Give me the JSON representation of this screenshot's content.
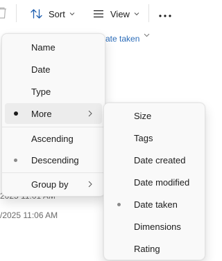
{
  "toolbar": {
    "sort_label": "Sort",
    "view_label": "View"
  },
  "background": {
    "column_header_fragment": "ate taken",
    "rows": [
      "2025 11:01 AM",
      "/2025 11:06 AM"
    ]
  },
  "sort_menu": {
    "items": [
      {
        "label": "Name"
      },
      {
        "label": "Date"
      },
      {
        "label": "Type"
      },
      {
        "label": "More",
        "checked": true,
        "submenu": true
      },
      {
        "label": "Ascending"
      },
      {
        "label": "Descending",
        "checked": true
      },
      {
        "label": "Group by",
        "submenu": true
      }
    ]
  },
  "more_submenu": {
    "items": [
      {
        "label": "Size"
      },
      {
        "label": "Tags"
      },
      {
        "label": "Date created"
      },
      {
        "label": "Date modified"
      },
      {
        "label": "Date taken",
        "checked": true
      },
      {
        "label": "Dimensions"
      },
      {
        "label": "Rating"
      }
    ]
  },
  "icons": {
    "trash": "trash-icon",
    "sort": "sort-arrows-icon",
    "view": "view-lines-icon",
    "more": "more-ellipsis-icon",
    "chevron": "chevron-down-icon",
    "submenu_arrow": "chevron-right-icon"
  }
}
